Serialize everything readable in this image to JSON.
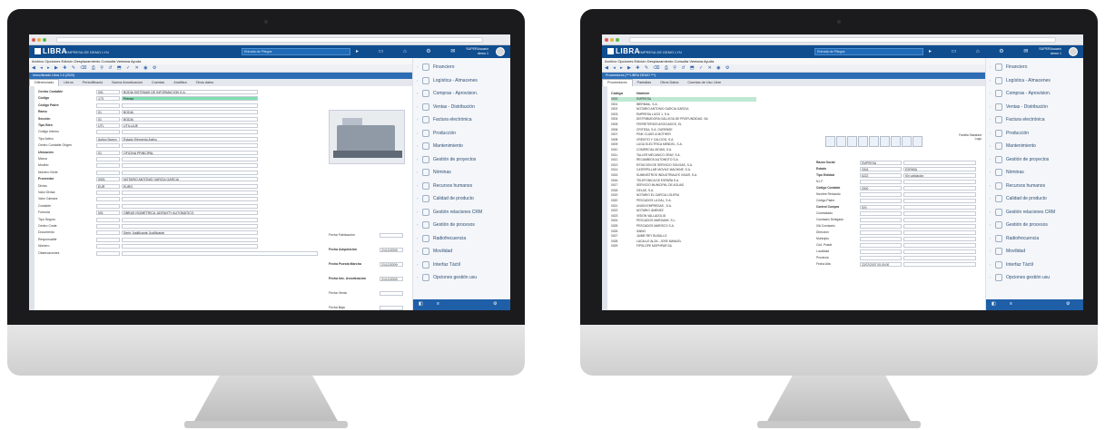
{
  "app": {
    "logo": "LIBRA",
    "company": "EMPRESA DE DEMO LYN",
    "search_placeholder": "Entrada de Pliegos",
    "user_line1": "SUPERUsuario",
    "user_line2": "demo 1"
  },
  "left": {
    "menu": "Archivo  Opciones  Edición  Desplazamiento  Consulta  Ventana  Ayuda",
    "doc_title": "Inmovilizado Libra 1.0 (2020)",
    "tabs": [
      "Diferenciado",
      "Libros",
      "Periodificacio",
      "Nueva Amortizacion",
      "Cuentas",
      "Analitica",
      "Otros datos"
    ],
    "fields": [
      {
        "label": "Centro Contable",
        "code": "001",
        "value": "BODIA SISTEMAS DE INFORMACION S.A."
      },
      {
        "label": "Código",
        "code": "173",
        "value": "Prensa"
      },
      {
        "label": "Código Padre",
        "code": "",
        "value": ""
      },
      {
        "label": "Ramo",
        "code": "01",
        "value": "BODIA"
      },
      {
        "label": "Sección",
        "code": "01",
        "value": "BODIA"
      },
      {
        "label": "Tipo Bien",
        "code": "UTL",
        "value": "UTILLAJE"
      },
      {
        "label": "Código Interno",
        "code": "",
        "value": ""
      },
      {
        "label": "Tipo Activo",
        "code": "Activo Nuevo",
        "value": "Estado Elemento   Activo"
      },
      {
        "label": "Centro Contable Origen",
        "code": "",
        "value": ""
      },
      {
        "label": "Ubicación",
        "code": "01",
        "value": "OFICINA PRINCIPAL"
      },
      {
        "label": "Marca",
        "code": "",
        "value": ""
      },
      {
        "label": "Modelo",
        "code": "",
        "value": ""
      },
      {
        "label": "Número Serie",
        "code": "",
        "value": ""
      },
      {
        "label": "Proveedor",
        "code": "0001",
        "value": "NOTARIO ANTONIO GARCIA GARCIA"
      },
      {
        "label": "Divisa",
        "code": "EUR",
        "value": "EURO"
      },
      {
        "label": "Valor Divisa",
        "code": "",
        "value": ""
      },
      {
        "label": "Valor Cámara",
        "code": "",
        "value": ""
      },
      {
        "label": "Contable",
        "code": "",
        "value": ""
      },
      {
        "label": "Fórmula",
        "code": "001",
        "value": "OBRAS ISOMÉTRICA: ADFAVITY AUTOMÁTICO"
      },
      {
        "label": "Tipo Seguro",
        "code": "",
        "value": ""
      },
      {
        "label": "Centro Coste",
        "code": "",
        "value": ""
      },
      {
        "label": "Documento",
        "code": "",
        "value": "Serie Justificante        Justificante"
      },
      {
        "label": "Responsable",
        "code": "",
        "value": ""
      },
      {
        "label": "Número",
        "code": "",
        "value": ""
      },
      {
        "label": "Observaciones",
        "code": "",
        "value": ""
      }
    ],
    "right_fields": [
      {
        "label": "Fecha Fabricación",
        "value": ""
      },
      {
        "label": "Fecha Adquisición",
        "value": "21/12/2009"
      },
      {
        "label": "Fecha Puesta Marcha",
        "value": "21/12/2009"
      },
      {
        "label": "Fecha Inic. Amortización",
        "value": "21/12/2009"
      },
      {
        "label": "Fecha Venta",
        "value": ""
      },
      {
        "label": "Fecha Baja",
        "value": ""
      }
    ]
  },
  "right": {
    "menu": "Archivo  Opciones  Edición  Desplazamiento  Consulta  Ventana  Ayuda",
    "doc_title": "Proveedores (***LIBRA DEMO ***)",
    "tabs": [
      "Proveedores",
      "Pantallas",
      "Otros Datos",
      "Cuentas de Uso Libre"
    ],
    "list_header": {
      "code": "Código",
      "name": "Nombre"
    },
    "rows": [
      {
        "code": "0000",
        "name": "EMPRESA"
      },
      {
        "code": "0001",
        "name": "IBERMAIL, S.A."
      },
      {
        "code": "0002",
        "name": "NOTARIO ANTONIO GARCIA GARCIA"
      },
      {
        "code": "0003",
        "name": "EMPRESA LUGO 1, S.A."
      },
      {
        "code": "0004",
        "name": "DISTRIBUIDORA GALLEGA DE PROFUNDIDAD, SA"
      },
      {
        "code": "0005",
        "name": "FERRETERIOS ASOCIADOS, SL"
      },
      {
        "code": "0006",
        "name": "CRITESA, S.A. OURENSE"
      },
      {
        "code": "0007",
        "name": "PINK CLASS & MOTHER"
      },
      {
        "code": "0008",
        "name": "CREDITO Y CALCIOS, S.A."
      },
      {
        "code": "0009",
        "name": "LUGA ELECTRICA MENDEL, S.A."
      },
      {
        "code": "0010",
        "name": "COMERCIAL MOIAS, S.A."
      },
      {
        "code": "0011",
        "name": "TALLER MECANICO ORAY, S.A."
      },
      {
        "code": "0012",
        "name": "RECAMBIOS AUTOMOTO S.A."
      },
      {
        "code": "0013",
        "name": "ESTACION DE SERVICIO SOLISAS, S.A."
      },
      {
        "code": "0014",
        "name": "CATERPILLAR MOVILE MACHINE, S.A."
      },
      {
        "code": "0015",
        "name": "SUMINISTROS INDUSTRIALES VIGAR, S.A."
      },
      {
        "code": "0016",
        "name": "TELEFONICA DE ESPAÑA S.A."
      },
      {
        "code": "0017",
        "name": "SERVICIO MUNICIPAL DE AGUAS"
      },
      {
        "code": "0018",
        "name": "GELAS, S.A."
      },
      {
        "code": "0019",
        "name": "NOTARIO EL GARCIA LOLERA"
      },
      {
        "code": "0020",
        "name": "PESCADOS LA DAL, S.A."
      },
      {
        "code": "0021",
        "name": "UNION EMPRESAS , S.A."
      },
      {
        "code": "0022",
        "name": "NOTARIO JIMENEZ"
      },
      {
        "code": "0023",
        "name": "VISION VALLADOLID"
      },
      {
        "code": "0024",
        "name": "PESCADOS MARDANK, S.L."
      },
      {
        "code": "0025",
        "name": "PESCADOS MARISCO S.A."
      },
      {
        "code": "0026",
        "name": "SABIO"
      },
      {
        "code": "0027",
        "name": "JAIME REY BUSALLO"
      },
      {
        "code": "0028",
        "name": "LACALLE ALZA - JOSE MANUEL"
      },
      {
        "code": "0029",
        "name": "FIPSLOPE MOPHPAR SA"
      }
    ],
    "detail_fields": [
      {
        "label": "Razón Social",
        "value": "EMPRESA",
        "value2": ""
      },
      {
        "label": "Estado",
        "value": "0004",
        "value2": "ESPAÑA"
      },
      {
        "label": "Tipo Entidad",
        "value": "6222",
        "value2": "Sin validación"
      },
      {
        "label": "N.I.F.",
        "value": "",
        "value2": ""
      },
      {
        "label": "Código Contable",
        "value": "0000",
        "value2": ""
      },
      {
        "label": "Nombre Reducido",
        "value": "",
        "value2": ""
      },
      {
        "label": "Código Padre",
        "value": "",
        "value2": ""
      },
      {
        "label": "Control Compra",
        "value": "S/N",
        "value2": ""
      },
      {
        "label": "Contrastado",
        "value": "",
        "value2": ""
      },
      {
        "label": "Comisario Delegado",
        "value": "",
        "value2": ""
      },
      {
        "label": "IVA Comisario",
        "value": "",
        "value2": ""
      },
      {
        "label": "Dirección",
        "value": "",
        "value2": ""
      },
      {
        "label": "Municipio",
        "value": "",
        "value2": ""
      },
      {
        "label": "Cód. Postal",
        "value": "",
        "value2": ""
      },
      {
        "label": "Localidad",
        "value": "",
        "value2": ""
      },
      {
        "label": "Provincia",
        "value": "",
        "value2": ""
      },
      {
        "label": "Fecha Alta",
        "value": "22/07/2007 00:00:00",
        "value2": ""
      }
    ],
    "family_label": "Familia Standard",
    "family_value": "Logo"
  },
  "sidebar": {
    "items": [
      {
        "label": "Financiero",
        "icon": "coins-icon"
      },
      {
        "label": "Logística - Almacenes",
        "icon": "warehouse-icon"
      },
      {
        "label": "Compras - Aprovision.",
        "icon": "cart-icon"
      },
      {
        "label": "Ventas - Distribución",
        "icon": "truck-icon"
      },
      {
        "label": "Factura electrónica",
        "icon": "invoice-icon"
      },
      {
        "label": "Producción",
        "icon": "factory-icon"
      },
      {
        "label": "Mantenimiento",
        "icon": "wrench-icon"
      },
      {
        "label": "Gestión de proyectos",
        "icon": "project-icon"
      },
      {
        "label": "Nóminas",
        "icon": "payroll-icon"
      },
      {
        "label": "Recursos humanos",
        "icon": "people-icon"
      },
      {
        "label": "Calidad de producto",
        "icon": "quality-icon"
      },
      {
        "label": "Gestión relaciones CRM",
        "icon": "crm-icon"
      },
      {
        "label": "Gestión de procesos",
        "icon": "process-icon"
      },
      {
        "label": "Radiofrecuencia",
        "icon": "radio-icon"
      },
      {
        "label": "Movilidad",
        "icon": "mobile-icon"
      },
      {
        "label": "Interfaz Táctil",
        "icon": "touch-icon"
      },
      {
        "label": "Opciones gestión usu",
        "icon": "options-icon"
      }
    ]
  },
  "colors": {
    "header": "#0f4d8f",
    "accent": "#2d6db5",
    "selected_row": "#bfe8d3"
  }
}
